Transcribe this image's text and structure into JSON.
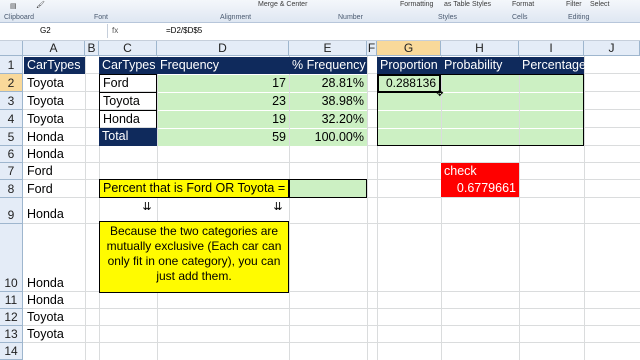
{
  "ribbon": {
    "groups": [
      "Clipboard",
      "Font",
      "Alignment",
      "Number",
      "Styles",
      "Cells",
      "Editing"
    ],
    "merge_center": "Merge & Center",
    "formatting": "Formatting",
    "as_table": "as Table",
    "styles_btn": "Styles",
    "format_btn": "Format",
    "filter_btn": "Filter",
    "select_btn": "Select"
  },
  "formula_bar": {
    "name_box": "G2",
    "fx": "fx",
    "formula": "=D2/$D$5"
  },
  "columns": [
    "A",
    "B",
    "C",
    "D",
    "E",
    "F",
    "G",
    "H",
    "I",
    "J"
  ],
  "rows": [
    "1",
    "2",
    "3",
    "4",
    "5",
    "6",
    "7",
    "8",
    "9",
    "10",
    "11",
    "12",
    "13",
    "14"
  ],
  "col_a": [
    "CarTypes",
    "Toyota",
    "Toyota",
    "Toyota",
    "Honda",
    "Honda",
    "Ford",
    "Ford",
    "Honda",
    "Honda",
    "Honda",
    "Toyota",
    "Toyota"
  ],
  "freq_table": {
    "headers": [
      "CarTypes",
      "Frequency",
      "% Frequency"
    ],
    "rows": [
      {
        "type": "Ford",
        "freq": "17",
        "pct": "28.81%"
      },
      {
        "type": "Toyota",
        "freq": "23",
        "pct": "38.98%"
      },
      {
        "type": "Honda",
        "freq": "19",
        "pct": "32.20%"
      },
      {
        "type": "Total",
        "freq": "59",
        "pct": "100.00%"
      }
    ]
  },
  "prob_table": {
    "headers": [
      "Proportion",
      "Probability",
      "Percentage"
    ],
    "g2_value": "0.288136"
  },
  "check": {
    "label": "check",
    "value": "0.6779661"
  },
  "question": "Percent that is Ford OR Toyota =",
  "note_text": "Because the two categories are mutually exclusive (Each car can only fit in one category), you can just add them.",
  "arrow_glyph": "⇊",
  "colors": {
    "navy": "#0f2a5c",
    "green": "#ccf0c3",
    "yellow": "#fffb00",
    "red": "#ff0000"
  }
}
